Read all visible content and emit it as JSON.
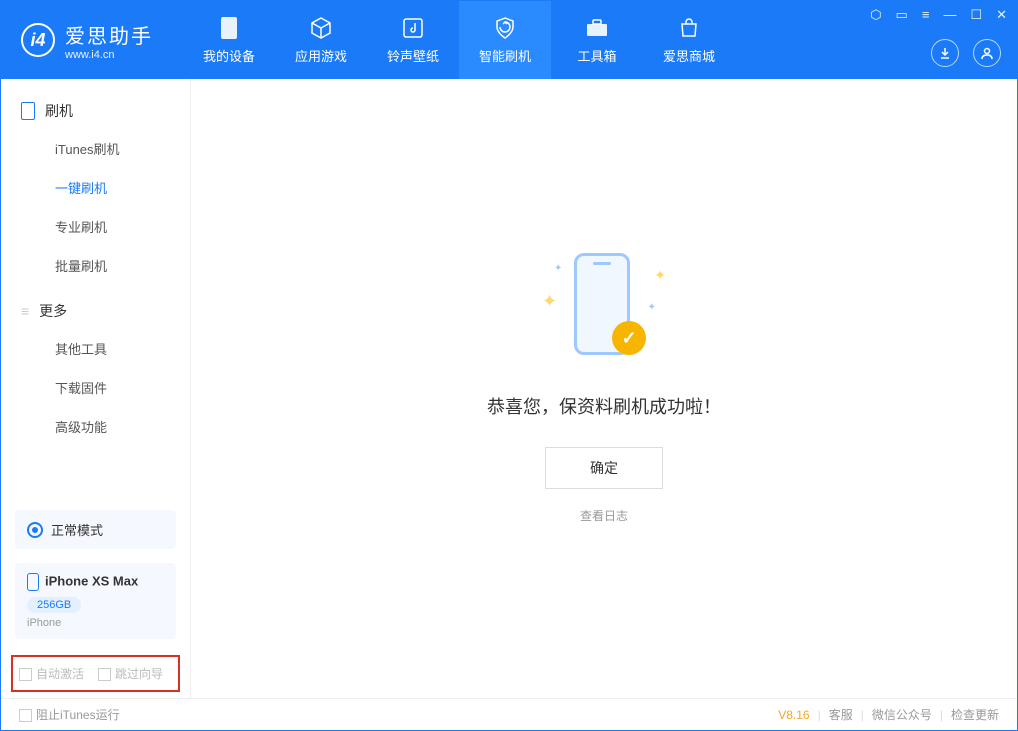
{
  "app": {
    "title": "爱思助手",
    "url": "www.i4.cn"
  },
  "tabs": [
    {
      "label": "我的设备"
    },
    {
      "label": "应用游戏"
    },
    {
      "label": "铃声壁纸"
    },
    {
      "label": "智能刷机"
    },
    {
      "label": "工具箱"
    },
    {
      "label": "爱思商城"
    }
  ],
  "sidebar": {
    "group1": {
      "title": "刷机",
      "items": [
        "iTunes刷机",
        "一键刷机",
        "专业刷机",
        "批量刷机"
      ]
    },
    "group2": {
      "title": "更多",
      "items": [
        "其他工具",
        "下载固件",
        "高级功能"
      ]
    }
  },
  "device": {
    "mode": "正常模式",
    "name": "iPhone XS Max",
    "storage": "256GB",
    "type": "iPhone"
  },
  "checkboxes": {
    "auto_activate": "自动激活",
    "skip_guide": "跳过向导"
  },
  "main": {
    "success_msg": "恭喜您，保资料刷机成功啦！",
    "ok_button": "确定",
    "view_log": "查看日志"
  },
  "footer": {
    "block_itunes": "阻止iTunes运行",
    "version": "V8.16",
    "links": [
      "客服",
      "微信公众号",
      "检查更新"
    ]
  }
}
